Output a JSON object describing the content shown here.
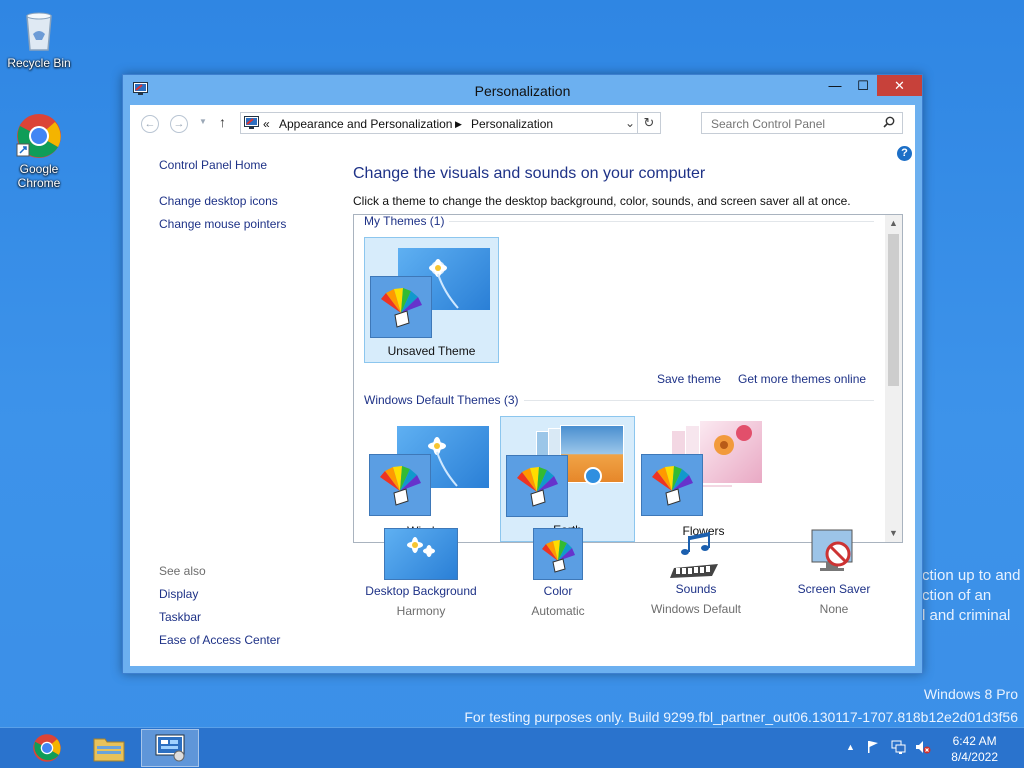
{
  "desktop": {
    "icons": [
      {
        "label": "Recycle Bin"
      },
      {
        "label": "Google Chrome"
      }
    ],
    "background_text": [
      "ction up to and",
      "ction of an",
      "l and criminal"
    ],
    "watermark": {
      "edition": "Windows 8 Pro",
      "build": "For testing purposes only. Build 9299.fbl_partner_out06.130117-1707.818b12e2d01d3f56"
    }
  },
  "window": {
    "title": "Personalization",
    "controls": {
      "minimize": "—",
      "maximize": "☐",
      "close": "✕"
    },
    "address": {
      "breadcrumb": [
        "Appearance and Personalization",
        "Personalization"
      ],
      "prefix": "«"
    },
    "search": {
      "placeholder": "Search Control Panel"
    },
    "sidebar": {
      "home": "Control Panel Home",
      "links": [
        "Change desktop icons",
        "Change mouse pointers"
      ],
      "see_also_label": "See also",
      "see_also": [
        "Display",
        "Taskbar",
        "Ease of Access Center"
      ]
    },
    "main": {
      "heading": "Change the visuals and sounds on your computer",
      "description": "Click a theme to change the desktop background, color, sounds, and screen saver all at once.",
      "my_themes_label": "My Themes (1)",
      "my_themes": [
        {
          "name": "Unsaved Theme"
        }
      ],
      "save_theme": "Save theme",
      "get_more": "Get more themes online",
      "default_themes_label": "Windows Default Themes (3)",
      "default_themes": [
        {
          "name": "Windows"
        },
        {
          "name": "Earth"
        },
        {
          "name": "Flowers"
        }
      ]
    },
    "bottom": [
      {
        "name": "Desktop Background",
        "value": "Harmony"
      },
      {
        "name": "Color",
        "value": "Automatic"
      },
      {
        "name": "Sounds",
        "value": "Windows Default"
      },
      {
        "name": "Screen Saver",
        "value": "None"
      }
    ]
  },
  "taskbar": {
    "clock": {
      "time": "6:42 AM",
      "date": "8/4/2022"
    }
  },
  "colors": {
    "link": "#1e3287",
    "accent": "#6cb0f0",
    "close": "#c7413a"
  }
}
